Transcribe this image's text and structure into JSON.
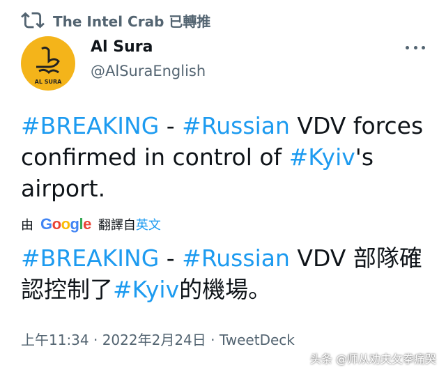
{
  "retweet": {
    "text": "The Intel Crab 已轉推",
    "icon": "retweet-icon"
  },
  "author": {
    "avatar_text": "AL SURA",
    "avatar_color": "#f4b41a",
    "name": "Al Sura",
    "handle": "@AlSuraEnglish"
  },
  "more_icon": "more-options-icon",
  "tweet": {
    "tag1": "#BREAKING",
    "sep": " - ",
    "tag2": "#Russian",
    "text_a": " VDV forces confirmed in control of ",
    "tag3": "#Kyiv",
    "text_b": "'s airport."
  },
  "translation": {
    "prefix": "由",
    "provider": "Google",
    "label": "翻譯自",
    "language": "英文",
    "tag1": "#BREAKING",
    "sep": " - ",
    "tag2": "#Russian",
    "text_a": " VDV 部隊確認控制了",
    "tag3": "#Kyiv",
    "text_b": "的機場。"
  },
  "meta": {
    "text": "上午11:34 · 2022年2月24日 · TweetDeck"
  },
  "watermark": "头条 @师从劝夫攵拳痛哭",
  "colors": {
    "link": "#1d9bf0",
    "secondary": "#536471",
    "text": "#0f1419"
  }
}
